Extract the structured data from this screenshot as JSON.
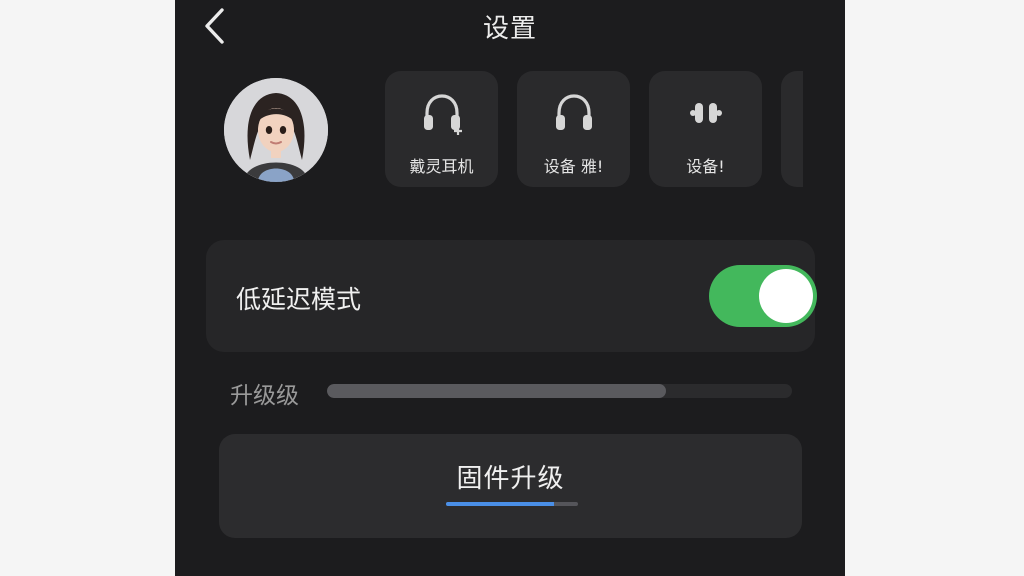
{
  "header": {
    "title": "设置",
    "back_icon": "chevron-left-icon"
  },
  "profile": {
    "avatar": "user-avatar-girl"
  },
  "devices": [
    {
      "label": "戴灵耳机",
      "icon": "headphones-add-icon"
    },
    {
      "label": "设备 雅!",
      "icon": "headphones-icon"
    },
    {
      "label": "设备!",
      "icon": "earbuds-icon"
    }
  ],
  "low_latency": {
    "label": "低延迟模式",
    "enabled": true,
    "on_color": "#43b85c"
  },
  "upgrade": {
    "label": "升级级",
    "progress": 0.73
  },
  "firmware": {
    "label": "固件升级",
    "progress": 0.82,
    "accent": "#4a8fe7"
  }
}
